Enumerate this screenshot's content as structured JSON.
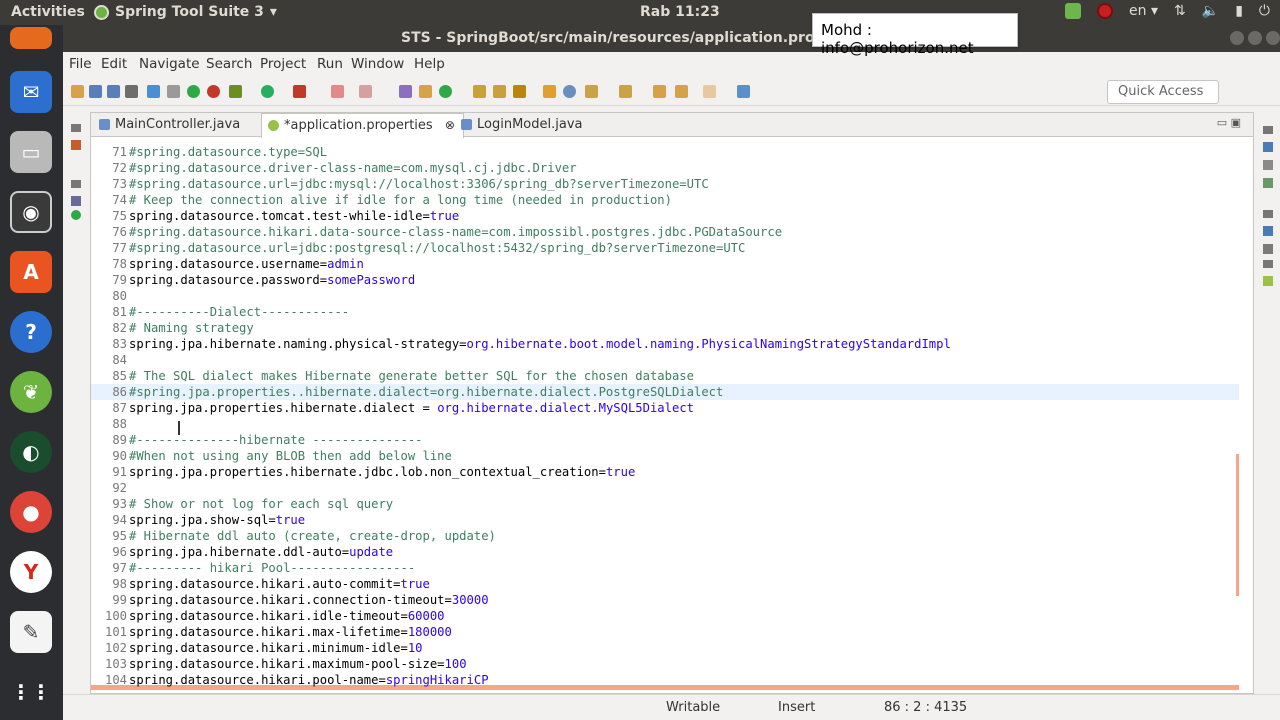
{
  "topbar": {
    "activities": "Activities",
    "app_name": "Spring Tool Suite 3",
    "clock": "Rab 11:23",
    "lang": "en"
  },
  "tooltip": {
    "text": "Mohd : info@prohorizon.net"
  },
  "window": {
    "title": "STS - SpringBoot/src/main/resources/application.properties -"
  },
  "menu": [
    "File",
    "Edit",
    "Navigate",
    "Search",
    "Project",
    "Run",
    "Window",
    "Help"
  ],
  "toolbar": {
    "quick_access": "Quick Access"
  },
  "tabs": [
    {
      "label": "MainController.java",
      "active": false
    },
    {
      "label": "*application.properties",
      "active": true,
      "close": "⊗"
    },
    {
      "label": "LoginModel.java",
      "active": false
    }
  ],
  "code_lines": [
    {
      "n": "71",
      "t": "#spring.datasource.type=SQL",
      "kind": "c"
    },
    {
      "n": "72",
      "t": "#spring.datasource.driver-class-name=com.mysql.cj.jdbc.Driver",
      "kind": "c"
    },
    {
      "n": "73",
      "t": "#spring.datasource.url=jdbc:mysql://localhost:3306/spring_db?serverTimezone=UTC",
      "kind": "c"
    },
    {
      "n": "74",
      "t": "# Keep the connection alive if idle for a long time (needed in production)",
      "kind": "c"
    },
    {
      "n": "75",
      "k": "spring.datasource.tomcat.test-while-idle=",
      "v": "true"
    },
    {
      "n": "76",
      "t": "#spring.datasource.hikari.data-source-class-name=com.impossibl.postgres.jdbc.PGDataSource",
      "kind": "c"
    },
    {
      "n": "77",
      "t": "#spring.datasource.url=jdbc:postgresql://localhost:5432/spring_db?serverTimezone=UTC",
      "kind": "c"
    },
    {
      "n": "78",
      "k": "spring.datasource.username=",
      "v": "admin"
    },
    {
      "n": "79",
      "k": "spring.datasource.password=",
      "v": "somePassword"
    },
    {
      "n": "80",
      "t": "",
      "kind": "c"
    },
    {
      "n": "81",
      "t": "#----------Dialect------------",
      "kind": "c"
    },
    {
      "n": "82",
      "t": "# Naming strategy",
      "kind": "c"
    },
    {
      "n": "83",
      "k": "spring.jpa.hibernate.naming.physical-strategy=",
      "v": "org.hibernate.boot.model.naming.PhysicalNamingStrategyStandardImpl"
    },
    {
      "n": "84",
      "t": "",
      "kind": "c"
    },
    {
      "n": "85",
      "t": "# The SQL dialect makes Hibernate generate better SQL for the chosen database",
      "kind": "c"
    },
    {
      "n": "86",
      "t": "#spring.jpa.properties..hibernate.dialect=org.hibernate.dialect.PostgreSQLDialect",
      "kind": "c",
      "hl": true
    },
    {
      "n": "87",
      "k": "spring.jpa.properties.hibernate.dialect = ",
      "v": "org.hibernate.dialect.MySQL5Dialect"
    },
    {
      "n": "88",
      "t": "",
      "kind": "c"
    },
    {
      "n": "89",
      "t": "#--------------hibernate ---------------",
      "kind": "c"
    },
    {
      "n": "90",
      "t": "#When not using any BLOB then add below line",
      "kind": "c"
    },
    {
      "n": "91",
      "k": "spring.jpa.properties.hibernate.jdbc.lob.non_contextual_creation=",
      "v": "true"
    },
    {
      "n": "92",
      "t": "",
      "kind": "c"
    },
    {
      "n": "93",
      "t": "# Show or not log for each sql query",
      "kind": "c"
    },
    {
      "n": "94",
      "k": "spring.jpa.show-sql=",
      "v": "true"
    },
    {
      "n": "95",
      "t": "# Hibernate ddl auto (create, create-drop, update)",
      "kind": "c"
    },
    {
      "n": "96",
      "k": "spring.jpa.hibernate.ddl-auto=",
      "v": "update"
    },
    {
      "n": "97",
      "t": "#--------- hikari Pool-----------------",
      "kind": "c"
    },
    {
      "n": "98",
      "k": "spring.datasource.hikari.auto-commit=",
      "v": "true"
    },
    {
      "n": "99",
      "k": "spring.datasource.hikari.connection-timeout=",
      "v": "30000"
    },
    {
      "n": "100",
      "k": "spring.datasource.hikari.idle-timeout=",
      "v": "60000"
    },
    {
      "n": "101",
      "k": "spring.datasource.hikari.max-lifetime=",
      "v": "180000"
    },
    {
      "n": "102",
      "k": "spring.datasource.hikari.minimum-idle=",
      "v": "10"
    },
    {
      "n": "103",
      "k": "spring.datasource.hikari.maximum-pool-size=",
      "v": "100"
    },
    {
      "n": "104",
      "k": "spring.datasource.hikari.pool-name=",
      "v": "springHikariCP"
    }
  ],
  "status": {
    "mode": "Writable",
    "insert": "Insert",
    "position": "86 : 2 : 4135"
  },
  "colors": {
    "comment": "#3f7f5f",
    "value": "#2a00ff",
    "highlight": "#e8f2fe"
  }
}
